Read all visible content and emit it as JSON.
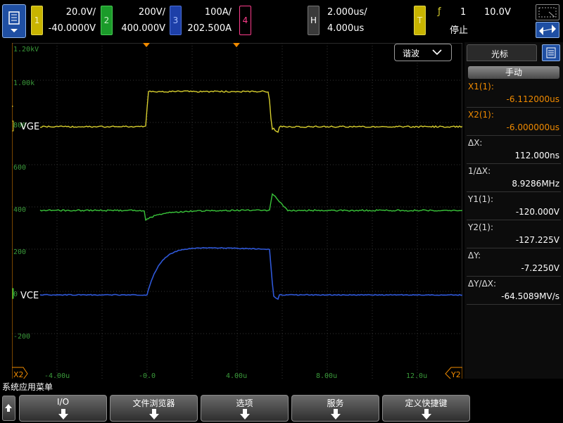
{
  "channels": [
    {
      "num": "1",
      "scale": "20.0V/",
      "offset": "-40.0000V"
    },
    {
      "num": "2",
      "scale": "200V/",
      "offset": "400.000V"
    },
    {
      "num": "3",
      "scale": "100A/",
      "offset": "202.500A"
    },
    {
      "num": "4"
    }
  ],
  "horizontal": {
    "badge": "H",
    "scale": "2.000us/",
    "position": "4.000us"
  },
  "trigger": {
    "badge": "T",
    "slope": "ƒ",
    "source": "1",
    "level": "10.0V",
    "status": "停止"
  },
  "scope": {
    "acq_mode": "谐波",
    "y_grid_labels": [
      "1.20kV",
      "1.00k",
      "800",
      "600",
      "400",
      "200",
      "0",
      "-200"
    ],
    "x_grid_labels": [
      "-4.00u",
      "-0.0",
      "4.00u",
      "8.00u",
      "12.0u"
    ],
    "trace_labels": {
      "vge": "VGE",
      "vce": "VCE"
    },
    "markers": {
      "t": "T",
      "one": "1",
      "two": "2",
      "x2_left": "X2",
      "y2_right": "Y2"
    }
  },
  "panel": {
    "title": "光标",
    "mode": "手动",
    "rows": [
      {
        "label": "X1(1):",
        "value": "-6.112000us",
        "orange": true
      },
      {
        "label": "X2(1):",
        "value": "-6.000000us",
        "orange": true
      },
      {
        "label": "ΔX:",
        "value": "112.000ns"
      },
      {
        "label": "1/ΔX:",
        "value": "8.9286MHz"
      },
      {
        "label": "Y1(1):",
        "value": "-120.000V"
      },
      {
        "label": "Y2(1):",
        "value": "-127.225V"
      },
      {
        "label": "ΔY:",
        "value": "-7.2250V"
      },
      {
        "label": "ΔY/ΔX:",
        "value": "-64.5089MV/s"
      }
    ]
  },
  "softkeys": {
    "menu_title": "系统应用菜单",
    "keys": [
      "I/O",
      "文件浏览器",
      "选项",
      "服务",
      "定义快捷键"
    ]
  },
  "colors": {
    "ch1": "#d8cf2e",
    "ch2": "#39c43a",
    "ch3": "#2f58d8",
    "ch4": "#ff3c8c",
    "grid": "#3a3a3a",
    "cursor": "#f08a00"
  }
}
